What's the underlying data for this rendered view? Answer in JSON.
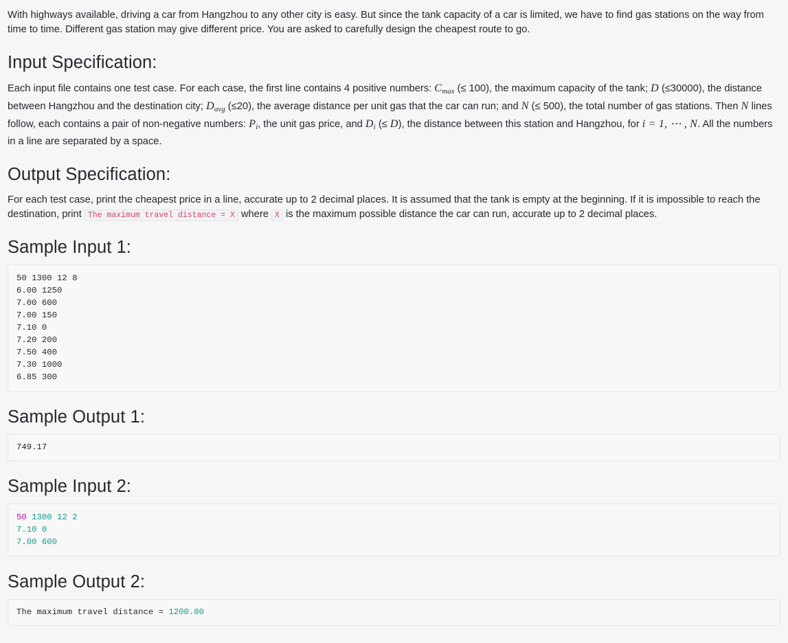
{
  "intro": {
    "text": "With highways available, driving a car from Hangzhou to any other city is easy. But since the tank capacity of a car is limited, we have to find gas stations on the way from time to time. Different gas station may give different price. You are asked to carefully design the cheapest route to go."
  },
  "input_spec": {
    "heading": "Input Specification:",
    "p1_a": "Each input file contains one test case. For each case, the first line contains 4 positive numbers: ",
    "sym_cmax": "C",
    "sym_cmax_sub": "max",
    "p1_b": " (≤ 100), the maximum capacity of the tank; ",
    "sym_d": "D",
    "p1_c": " (≤30000), the distance between Hangzhou and the destination city; ",
    "sym_davg": "D",
    "sym_davg_sub": "avg",
    "p1_d": " (≤20), the average distance per unit gas that the car can run; and ",
    "sym_n": "N",
    "p1_e": " (≤ 500), the total number of gas stations. Then ",
    "sym_n2": "N",
    "p1_f": " lines follow, each contains a pair of non-negative numbers: ",
    "sym_p": "P",
    "sym_p_sub": "i",
    "p1_g": ", the unit gas price, and ",
    "sym_di": "D",
    "sym_di_sub": "i",
    "p1_h": " (≤ ",
    "sym_d2": "D",
    "p1_i": "), the distance between this station and Hangzhou, for ",
    "sym_range": "i = 1, ⋯ , N",
    "p1_j": ". All the numbers in a line are separated by a space."
  },
  "output_spec": {
    "heading": "Output Specification:",
    "p1_a": "For each test case, print the cheapest price in a line, accurate up to 2 decimal places. It is assumed that the tank is empty at the beginning. If it is impossible to reach the destination, print ",
    "code_msg": "The maximum travel distance = X",
    "p1_b": " where ",
    "code_x": "X",
    "p1_c": " is the maximum possible distance the car can run, accurate up to 2 decimal places."
  },
  "sample_input_1": {
    "heading": "Sample Input 1:",
    "lines": [
      "50 1300 12 8",
      "6.00 1250",
      "7.00 600",
      "7.00 150",
      "7.10 0",
      "7.20 200",
      "7.50 400",
      "7.30 1000",
      "6.85 300"
    ]
  },
  "sample_output_1": {
    "heading": "Sample Output 1:",
    "lines": [
      "749.17"
    ]
  },
  "sample_input_2": {
    "heading": "Sample Input 2:",
    "tokens": [
      [
        {
          "t": "50",
          "c": "tok-num"
        },
        {
          "t": " ",
          "c": "tok-plain"
        },
        {
          "t": "1300",
          "c": "tok-cyan"
        },
        {
          "t": " ",
          "c": "tok-plain"
        },
        {
          "t": "12",
          "c": "tok-cyan"
        },
        {
          "t": " ",
          "c": "tok-plain"
        },
        {
          "t": "2",
          "c": "tok-cyan"
        }
      ],
      [
        {
          "t": "7.10",
          "c": "tok-cyan"
        },
        {
          "t": " ",
          "c": "tok-plain"
        },
        {
          "t": "0",
          "c": "tok-cyan"
        }
      ],
      [
        {
          "t": "7.00",
          "c": "tok-cyan"
        },
        {
          "t": " ",
          "c": "tok-plain"
        },
        {
          "t": "600",
          "c": "tok-cyan"
        }
      ]
    ]
  },
  "sample_output_2": {
    "heading": "Sample Output 2:",
    "tokens": [
      [
        {
          "t": "The maximum travel distance = ",
          "c": "tok-plain"
        },
        {
          "t": "1200.00",
          "c": "tok-cyan"
        }
      ]
    ]
  },
  "colors": {
    "page_bg": "#f6f6f6",
    "text": "#24292e",
    "code_bg": "#f8f8f8",
    "code_border": "#e6e6e6",
    "inline_code_text": "#d6436e",
    "token_magenta": "#b5108f",
    "token_cyan": "#0f9c92"
  }
}
